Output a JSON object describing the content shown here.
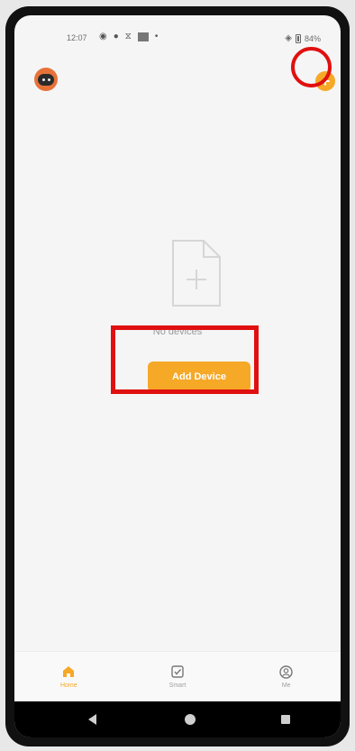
{
  "status_bar": {
    "time": "12:07",
    "battery": "84%"
  },
  "header": {
    "avatar_icon": "robot-avatar-icon",
    "add_button_icon": "plus-circle-icon",
    "add_button_label": "+"
  },
  "empty_state": {
    "icon": "file-plus-icon",
    "message": "No devices",
    "button_label": "Add Device"
  },
  "tabs": [
    {
      "label": "Home",
      "icon": "home-icon",
      "active": true
    },
    {
      "label": "Smart",
      "icon": "checkbox-icon",
      "active": false
    },
    {
      "label": "Me",
      "icon": "person-circle-icon",
      "active": false
    }
  ],
  "colors": {
    "accent": "#f6a827",
    "highlight": "#e01010",
    "background": "#f5f5f5"
  }
}
